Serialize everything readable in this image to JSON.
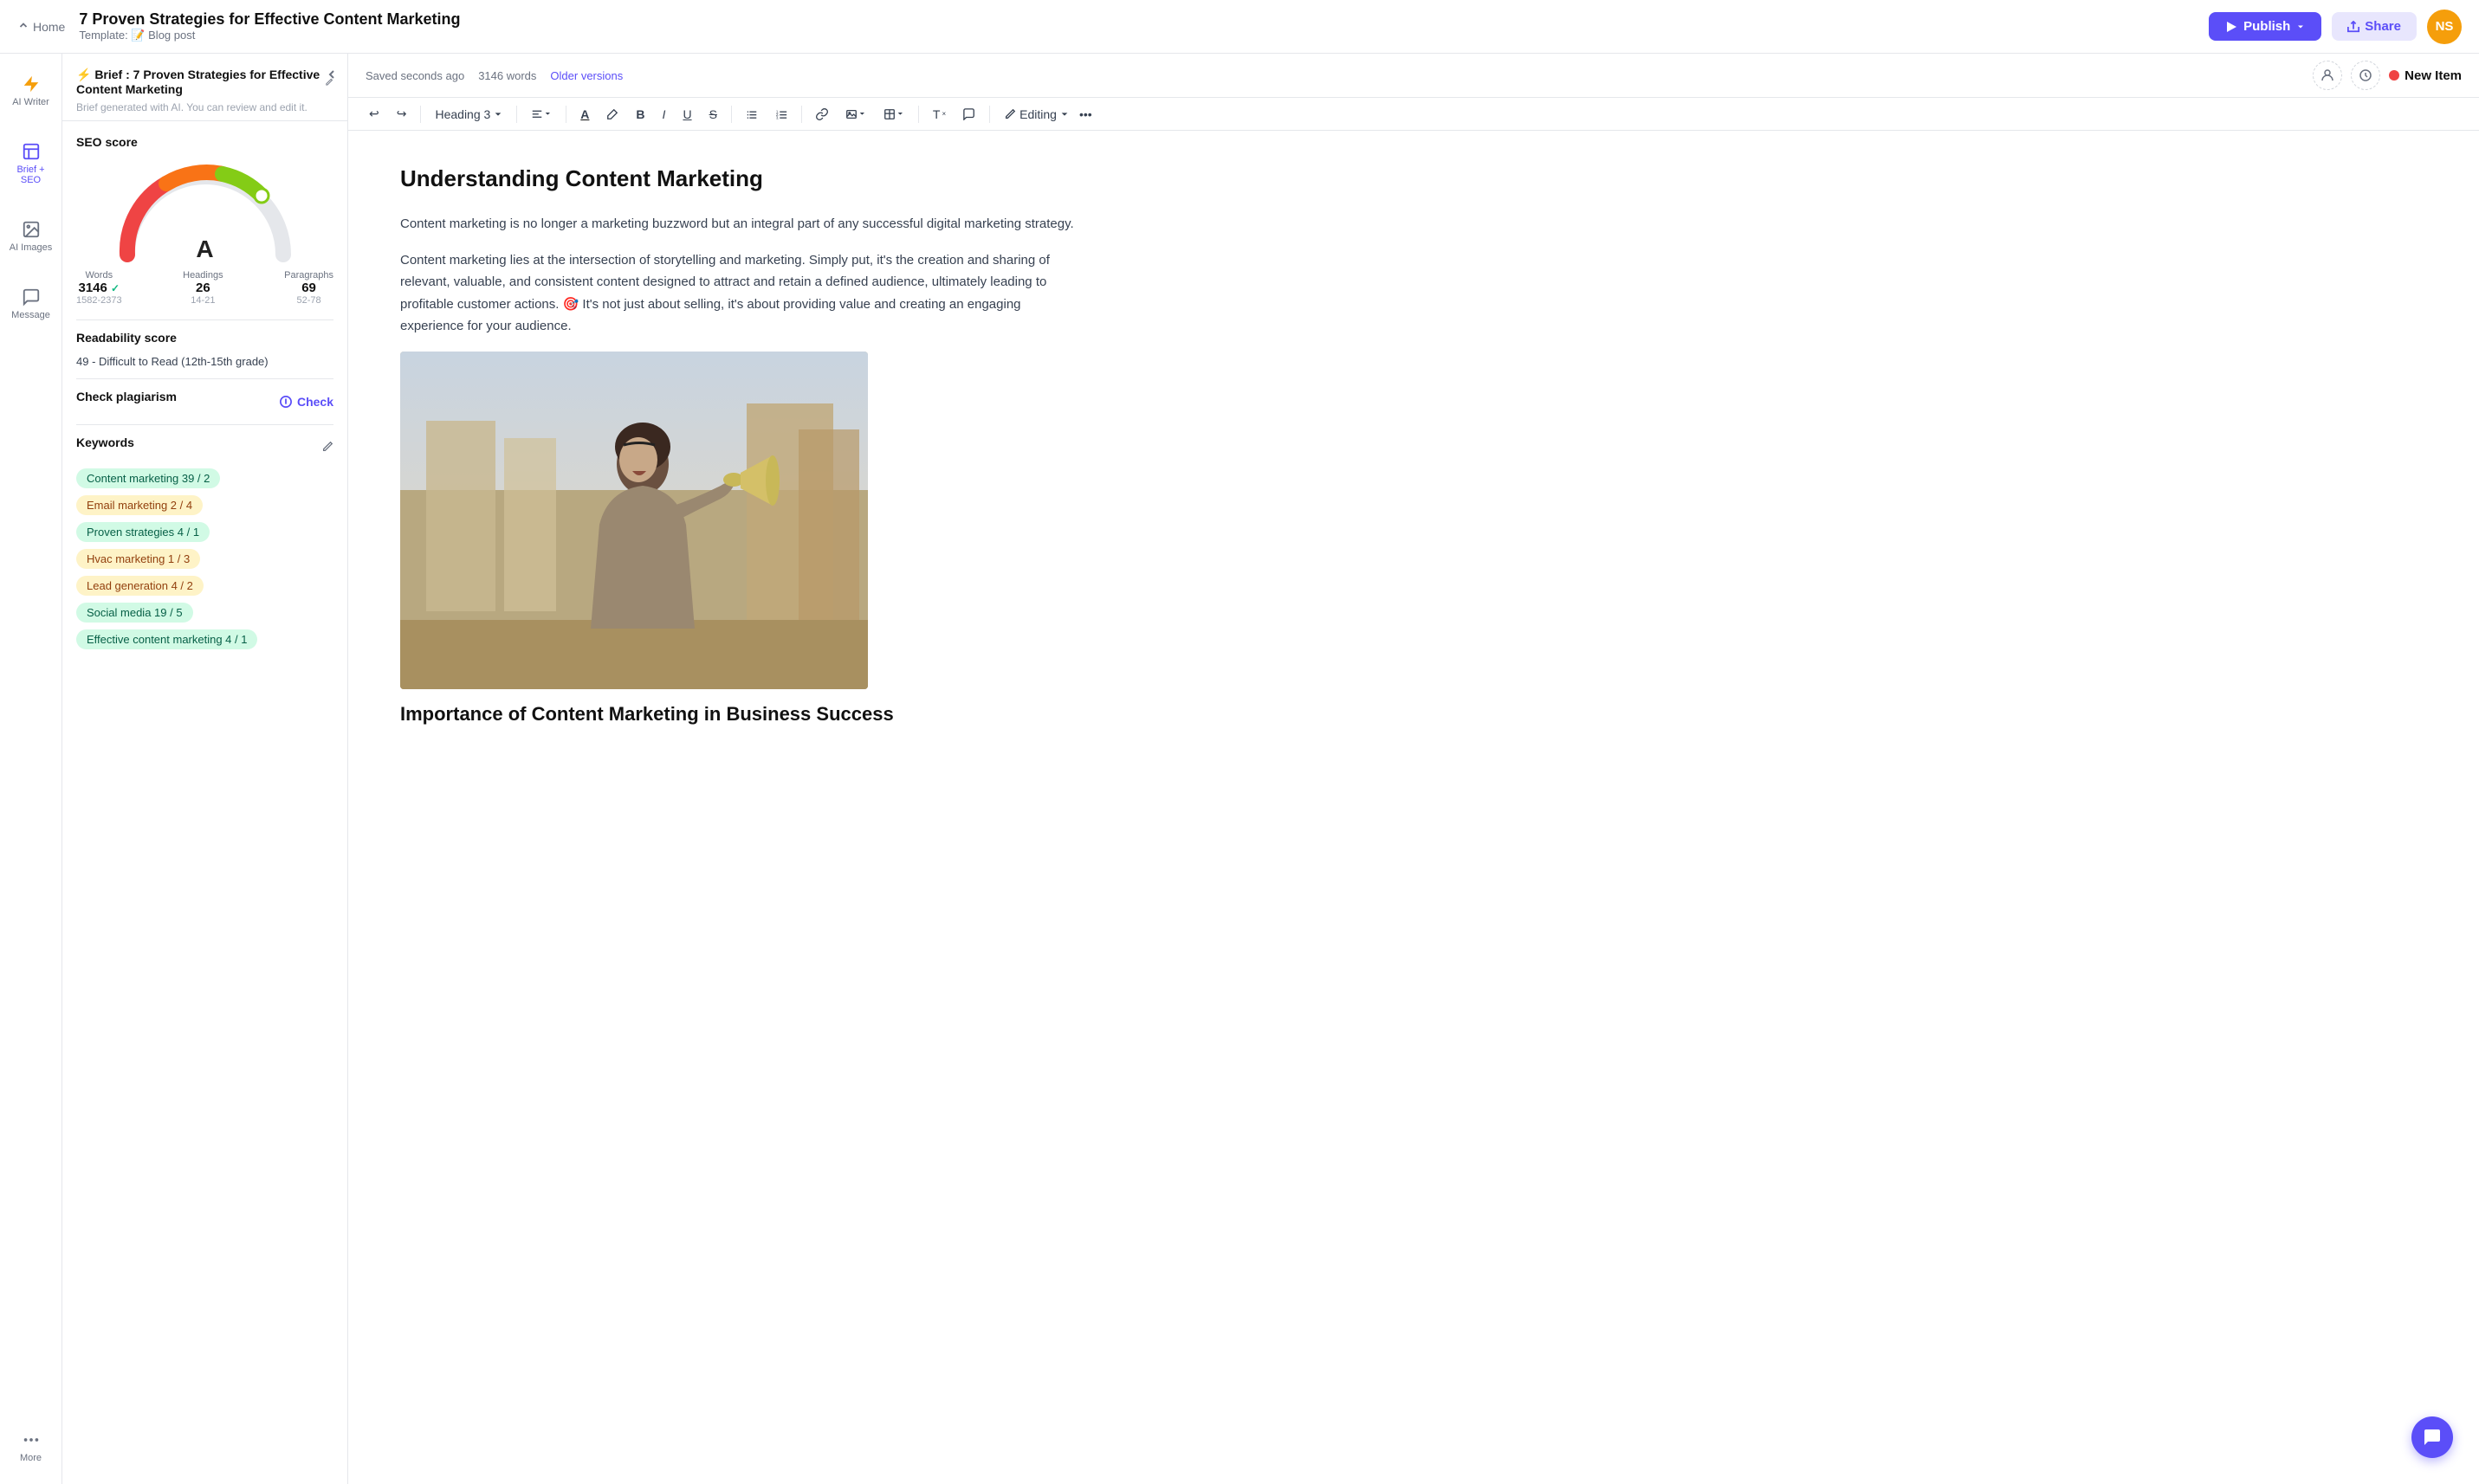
{
  "topbar": {
    "home_label": "Home",
    "title": "7 Proven Strategies for Effective Content Marketing",
    "template_label": "Template: 📝 Blog post",
    "publish_label": "Publish",
    "share_label": "Share",
    "avatar_initials": "NS"
  },
  "icon_sidebar": {
    "items": [
      {
        "id": "ai-writer",
        "icon": "bolt",
        "label": "AI Writer",
        "active": false
      },
      {
        "id": "brief-seo",
        "icon": "layers",
        "label": "Brief + SEO",
        "active": true
      },
      {
        "id": "ai-images",
        "icon": "image",
        "label": "AI Images",
        "active": false
      },
      {
        "id": "message",
        "icon": "message",
        "label": "Message",
        "active": false
      },
      {
        "id": "more",
        "icon": "dots",
        "label": "More",
        "active": false
      }
    ]
  },
  "brief_panel": {
    "title": "⚡ Brief : 7 Proven Strategies for Effective Content Marketing",
    "subtitle": "Brief generated with AI. You can review and edit it.",
    "seo_score": {
      "label": "SEO score",
      "grade": "A",
      "stats": [
        {
          "label": "Words",
          "value": "3146",
          "check": true,
          "range": "1582-2373"
        },
        {
          "label": "Headings",
          "value": "26",
          "check": false,
          "range": "14-21"
        },
        {
          "label": "Paragraphs",
          "value": "69",
          "check": false,
          "range": "52-78"
        }
      ]
    },
    "readability": {
      "label": "Readability score",
      "value": "49 - Difficult to Read (12th-15th grade)"
    },
    "plagiarism": {
      "label": "Check plagiarism",
      "check_label": "Check"
    },
    "keywords": {
      "label": "Keywords",
      "items": [
        {
          "text": "Content marketing  39 / 2",
          "style": "green"
        },
        {
          "text": "Email marketing  2 / 4",
          "style": "yellow"
        },
        {
          "text": "Proven strategies  4 / 1",
          "style": "green"
        },
        {
          "text": "Hvac marketing  1 / 3",
          "style": "yellow"
        },
        {
          "text": "Lead generation  4 / 2",
          "style": "yellow"
        },
        {
          "text": "Social media  19 / 5",
          "style": "green"
        },
        {
          "text": "Effective content marketing  4 / 1",
          "style": "green"
        }
      ]
    }
  },
  "editor": {
    "meta": {
      "saved": "Saved seconds ago",
      "words": "3146 words",
      "older_versions": "Older versions"
    },
    "new_item_label": "New Item",
    "toolbar": {
      "heading_select": "Heading 3",
      "editing_label": "Editing"
    },
    "content": {
      "h1": "Understanding Content Marketing",
      "p1": "Content marketing is no longer a marketing buzzword but an integral part of any successful digital marketing strategy.",
      "p2": "Content marketing lies at the intersection of storytelling and marketing. Simply put, it's the creation and sharing of relevant, valuable, and consistent content designed to attract and retain a defined audience, ultimately leading to profitable customer actions. 🎯 It's not just about selling, it's about providing value and creating an engaging experience for your audience.",
      "h2": "Importance of Content Marketing in Business Success"
    }
  }
}
